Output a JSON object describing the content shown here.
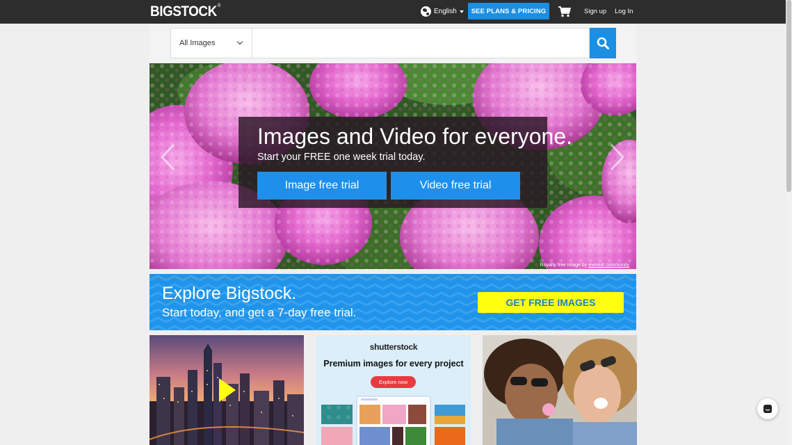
{
  "header": {
    "logo_text": "BIGSTOCK",
    "logo_mark": "®",
    "language": "English",
    "plans_button": "SEE PLANS & PRICING",
    "cart_icon": "shopping-cart-icon",
    "signup": "Sign up",
    "login": "Log In"
  },
  "search": {
    "type_selected": "All Images",
    "placeholder": "",
    "button_icon": "search-icon"
  },
  "hero": {
    "title": "Images and Video for everyone.",
    "subtitle": "Start your FREE one week trial today.",
    "image_trial_label": "Image free trial",
    "video_trial_label": "Video free trial",
    "credit_prefix": "Royalty free image by",
    "credit_author": "everest community"
  },
  "explore": {
    "title": "Explore Bigstock.",
    "subtitle": "Start today, and get a 7-day free trial.",
    "cta": "GET FREE IMAGES"
  },
  "cards": {
    "shutterstock_logo": "shutterstock",
    "shutterstock_headline": "Premium images for every project",
    "shutterstock_cta": "Explore now"
  },
  "colors": {
    "topbar": "#2d2d2d",
    "accent_blue": "#1a8fe3",
    "cta_yellow": "#ffff10"
  }
}
